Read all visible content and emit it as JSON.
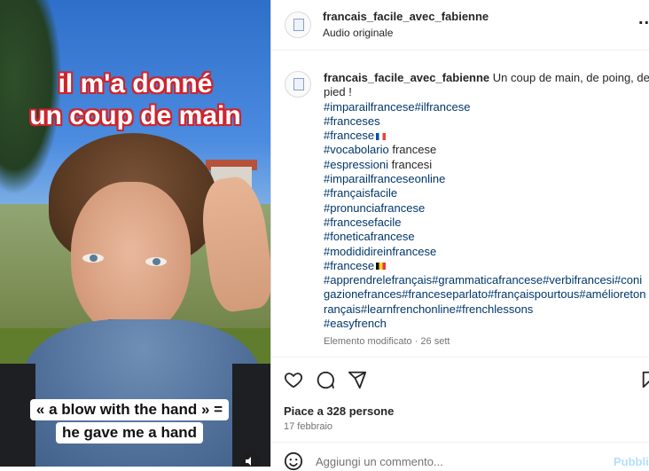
{
  "media": {
    "caption_line1": "il m'a donné",
    "caption_line2": "un coup de main",
    "subtitle_line1": "« a blow with the hand » =",
    "subtitle_line2": "he gave me a hand",
    "volume_icon": "speaker-icon"
  },
  "header": {
    "username": "francais_facile_avec_fabienne",
    "audio": "Audio originale",
    "more": "..."
  },
  "post": {
    "username": "francais_facile_avec_fabienne",
    "text": "Un coup de main, de poing, de",
    "text2": "pied !",
    "lines": [
      {
        "tag": "#imparailfrancese#ilfrancese",
        "plain": "",
        "flag": ""
      },
      {
        "tag": "#franceses",
        "plain": "",
        "flag": ""
      },
      {
        "tag": "#francese",
        "plain": "",
        "flag": "fr"
      },
      {
        "tag": "#vocabolario",
        "plain": " francese",
        "flag": ""
      },
      {
        "tag": "#espressioni",
        "plain": " francesi",
        "flag": ""
      },
      {
        "tag": "#imparailfranceseonline",
        "plain": "",
        "flag": ""
      },
      {
        "tag": "#françaisfacile",
        "plain": "",
        "flag": ""
      },
      {
        "tag": "#pronunciafrancese",
        "plain": "",
        "flag": ""
      },
      {
        "tag": "#francesefacile",
        "plain": "",
        "flag": ""
      },
      {
        "tag": "#foneticafrancese",
        "plain": "",
        "flag": ""
      },
      {
        "tag": "#modididireinfrancese",
        "plain": "",
        "flag": ""
      },
      {
        "tag": "#francese",
        "plain": "",
        "flag": "be"
      },
      {
        "tag": "#apprendrelefrançais#grammaticafrancese#verbifrancesi#coni",
        "plain": "",
        "flag": ""
      },
      {
        "tag": "gazionefrances#franceseparlato#françaispourtous#amélioreton",
        "plain": "",
        "flag": ""
      },
      {
        "tag": "rançais#learnfrenchonline#frenchlessons",
        "plain": "",
        "flag": ""
      },
      {
        "tag": "#easyfrench",
        "plain": "",
        "flag": ""
      }
    ],
    "edited": "Elemento modificato · 26 sett"
  },
  "actions": {
    "likes": "Piace a 328 persone",
    "date": "17 febbraio"
  },
  "comment": {
    "placeholder": "Aggiungi un commento...",
    "publish": "Pubblica"
  },
  "colors": {
    "hashtag": "#00376b",
    "caption_outline": "#d0232b",
    "publish_disabled": "#b2dffc"
  }
}
